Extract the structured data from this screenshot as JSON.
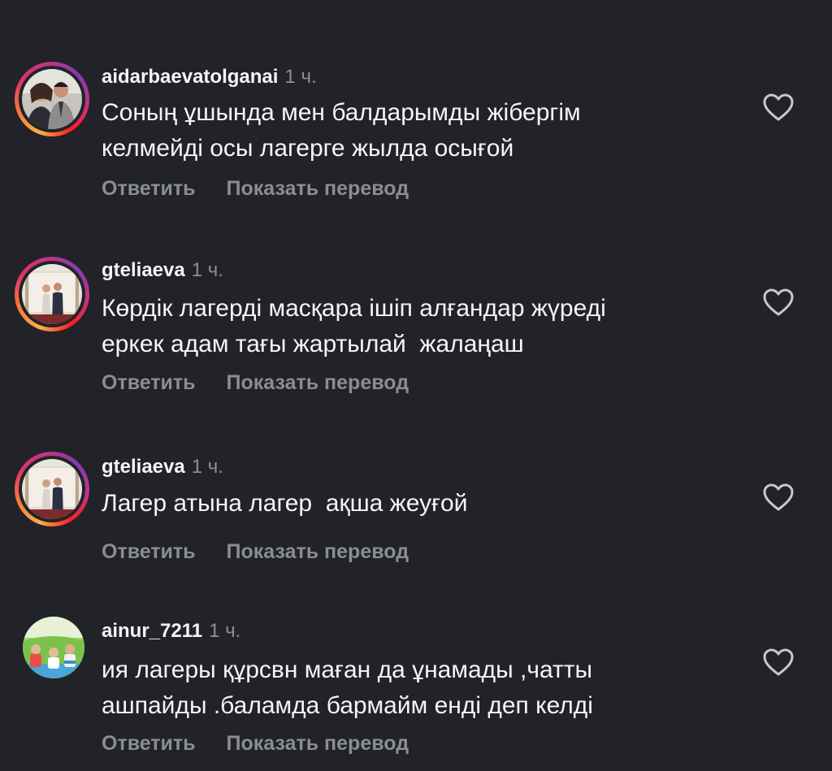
{
  "comments": [
    {
      "username": "aidarbaevatolganai",
      "time": "1 ч.",
      "text": "Соның ұшында мен балдарымды жібергім\nкелмейді осы лагерге жылда осығой",
      "reply_label": "Ответить",
      "translate_label": "Показать перевод",
      "avatar_icon": "person-photo-icon",
      "like_icon": "heart-outline-icon"
    },
    {
      "username": "gteliaeva",
      "time": "1 ч.",
      "text": "Көрдік лагерді масқара ішіп алғандар жүреді\nеркек адам тағы жартылай  жалаңаш",
      "reply_label": "Ответить",
      "translate_label": "Показать перевод",
      "avatar_icon": "couple-photo-icon",
      "like_icon": "heart-outline-icon"
    },
    {
      "username": "gteliaeva",
      "time": "1 ч.",
      "text": "Лагер атына лагер  ақша жеуғой",
      "reply_label": "Ответить",
      "translate_label": "Показать перевод",
      "avatar_icon": "couple-photo-icon",
      "like_icon": "heart-outline-icon"
    },
    {
      "username": "ainur_7211",
      "time": "1 ч.",
      "text": "ия лагеры құрсвн маған да ұнамады ,чатты\nашпайды .баламда бармайм енді деп келді",
      "reply_label": "Ответить",
      "translate_label": "Показать перевод",
      "avatar_icon": "children-photo-icon",
      "like_icon": "heart-outline-icon"
    }
  ],
  "colors": {
    "background": "#212328",
    "text": "#f5f5f5",
    "secondary": "#8a8d93",
    "story_ring_start": "#fcaf45",
    "story_ring_end": "#c13584"
  }
}
